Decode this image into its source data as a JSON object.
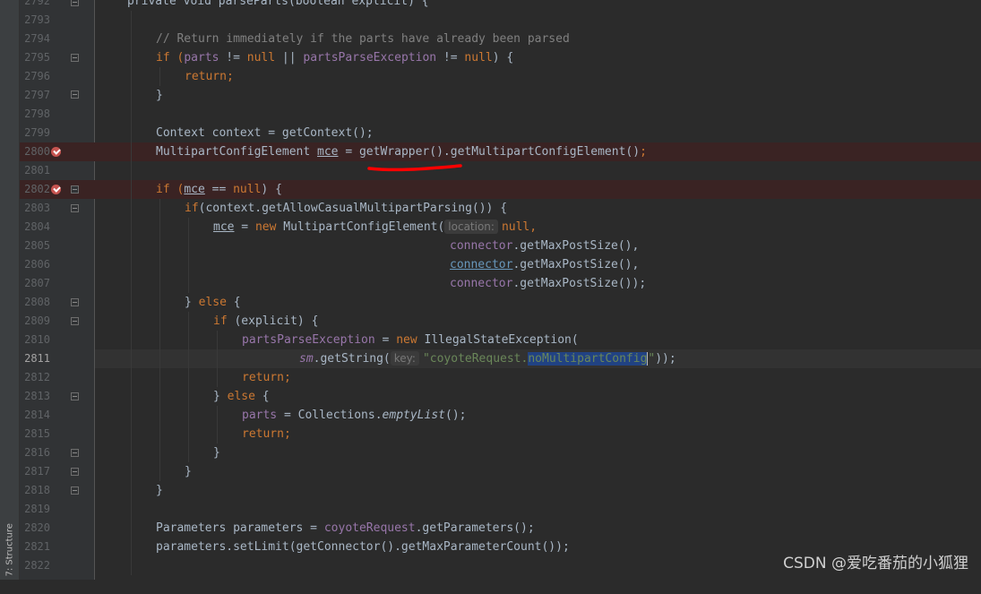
{
  "tool_window": {
    "structure_tab": "7: Structure"
  },
  "watermark": "CSDN @爱吃番茄的小狐狸",
  "colors": {
    "background": "#2b2b2b",
    "keyword": "#cc7832",
    "string": "#6a8759",
    "field": "#9876aa",
    "comment": "#808080",
    "breakpoint": "#c75450",
    "annotation": "#ff0000"
  },
  "editor": {
    "line_numbers": [
      "2792",
      "2793",
      "2794",
      "2795",
      "2796",
      "2797",
      "2798",
      "2799",
      "2800",
      "2801",
      "2802",
      "2803",
      "2804",
      "2805",
      "2806",
      "2807",
      "2808",
      "2809",
      "2810",
      "2811",
      "2812",
      "2813",
      "2814",
      "2815",
      "2816",
      "2817",
      "2818",
      "2819",
      "2820",
      "2821",
      "2822"
    ],
    "current_line": "2811",
    "breakpoint_lines": [
      "2800",
      "2802"
    ],
    "hints": {
      "location": "location:",
      "key": "key:"
    },
    "code": {
      "l2792": "private void parseParts(boolean explicit) {",
      "l2794": "// Return immediately if the parts have already been parsed",
      "l2795_if": "if (",
      "l2795_parts": "parts",
      "l2795_ne": " != ",
      "l2795_null": "null",
      "l2795_or": " || ",
      "l2795_ppe": "partsParseException",
      "l2795_ne2": " != ",
      "l2795_null2": "null",
      "l2795_end": ") {",
      "l2796": "return;",
      "l2797": "}",
      "l2799": "Context context = getContext();",
      "l2800_type": "MultipartConfigElement ",
      "l2800_var": "mce",
      "l2800_eq": " = ",
      "l2800_gw": "getWrapper",
      "l2800_rest": "().getMultipartConfigElement()",
      "l2800_semi": ";",
      "l2802_if": "if (",
      "l2802_var": "mce",
      "l2802_eq": " == ",
      "l2802_null": "null",
      "l2802_end": ") {",
      "l2803_if": "if",
      "l2803_rest": "(context.getAllowCasualMultipartParsing()) {",
      "l2804_var": "mce",
      "l2804_eq": " = ",
      "l2804_new": "new",
      "l2804_rest": " MultipartConfigElement(",
      "l2804_null": "null,",
      "l2805_conn": "connector",
      "l2805_rest": ".getMaxPostSize(),",
      "l2806_conn": "connector",
      "l2806_rest": ".getMaxPostSize(),",
      "l2807_conn": "connector",
      "l2807_rest": ".getMaxPostSize());",
      "l2808_close": "} ",
      "l2808_else": "else",
      "l2808_open": " {",
      "l2809_if": "if",
      "l2809_rest": " (explicit) {",
      "l2810_ppe": "partsParseException",
      "l2810_eq": " = ",
      "l2810_new": "new",
      "l2810_rest": " IllegalStateException(",
      "l2811_sm": "sm",
      "l2811_call": ".getString(",
      "l2811_q": "\"",
      "l2811_str": "coyoteRequest.",
      "l2811_sel": "noMultipartConfig",
      "l2811_end": "\"",
      "l2811_rest": "));",
      "l2812": "return;",
      "l2813_close": "} ",
      "l2813_else": "else",
      "l2813_open": " {",
      "l2814_parts": "parts",
      "l2814_eq": " = Collections.",
      "l2814_empty": "emptyList",
      "l2814_rest": "();",
      "l2815": "return;",
      "l2816": "}",
      "l2817": "}",
      "l2818": "}",
      "l2820_a": "Parameters parameters = ",
      "l2820_cr": "coyoteRequest",
      "l2820_b": ".getParameters();",
      "l2821": "parameters.setLimit(getConnector().getMaxParameterCount());"
    }
  }
}
